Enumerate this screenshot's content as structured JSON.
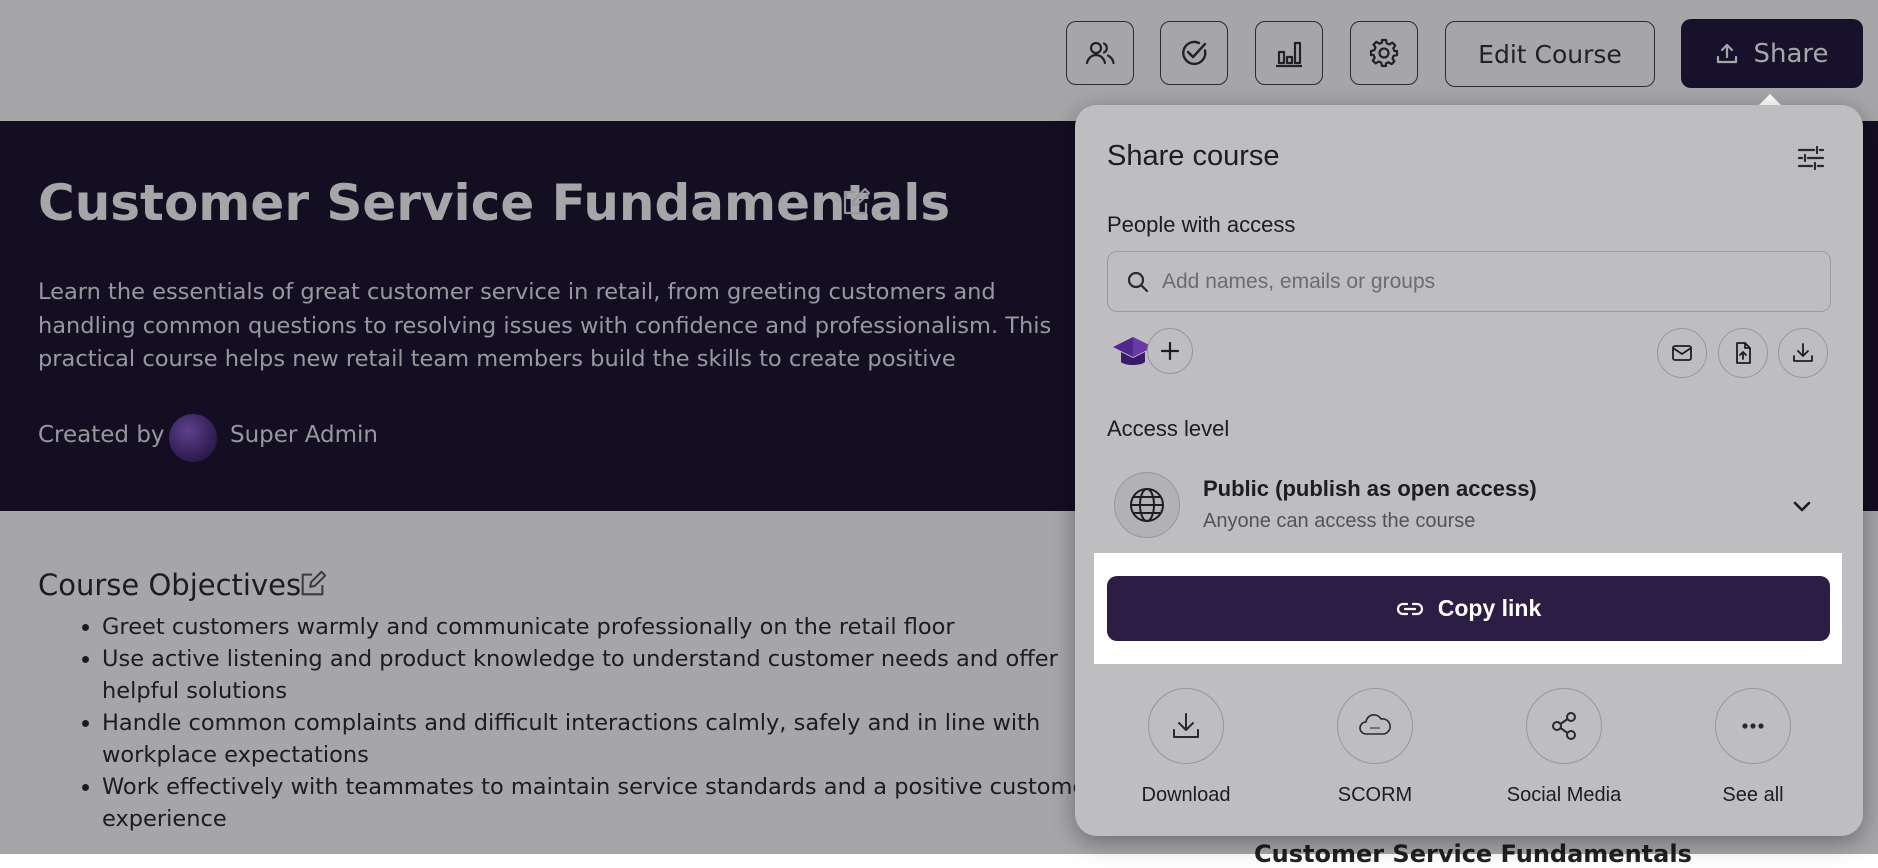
{
  "toolbar": {
    "icons": [
      "people-icon",
      "check-circle-icon",
      "bar-chart-icon",
      "gear-icon"
    ],
    "edit_course_label": "Edit Course",
    "share_label": "Share"
  },
  "course": {
    "title": "Customer Service Fundamentals",
    "description": "Learn the essentials of great customer service in retail, from greeting customers and handling common questions to resolving issues with confidence and professionalism. This practical course helps new retail team members build the skills to create positive customer experiences on the shop floor.",
    "created_by_label": "Created by",
    "creator_name": "Super Admin"
  },
  "objectives": {
    "title": "Course Objectives",
    "items": [
      "Greet customers warmly and communicate professionally on the retail floor",
      "Use active listening and product knowledge to understand customer needs and offer helpful solutions",
      "Handle common complaints and difficult interactions calmly, safely and in line with workplace expectations",
      "Work effectively with teammates to maintain service standards and a positive customer experience"
    ]
  },
  "sidebar_partial_title": "Customer Service Fundamentals",
  "share_popup": {
    "title": "Share course",
    "people_label": "People with access",
    "search_placeholder": "Add names, emails or groups",
    "access_level_label": "Access level",
    "access_title": "Public (publish as open access)",
    "access_subtitle": "Anyone can access the course",
    "copy_link_label": "Copy link",
    "export_options": [
      {
        "label": "Download",
        "icon": "download-icon"
      },
      {
        "label": "SCORM",
        "icon": "cloud-scorm-icon"
      },
      {
        "label": "Social Media",
        "icon": "share-icon"
      },
      {
        "label": "See all",
        "icon": "more-icon"
      }
    ]
  },
  "colors": {
    "hero_bg": "#130a24",
    "primary": "#2b1d43",
    "share_button": "#1a0f35"
  }
}
